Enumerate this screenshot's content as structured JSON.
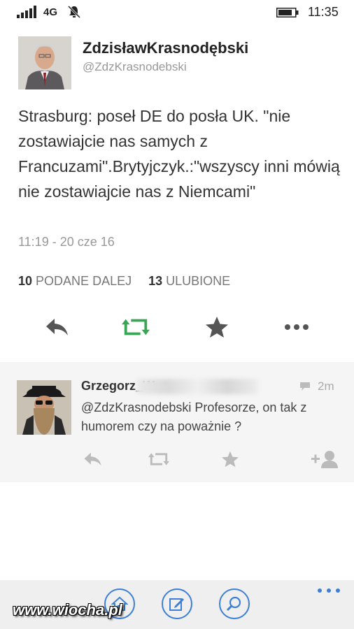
{
  "status_bar": {
    "network": "4G",
    "time": "11:35"
  },
  "tweet": {
    "author_name": "ZdzisławKrasnodębski",
    "author_handle": "@ZdzKrasnodebski",
    "text": "Strasburg: poseł DE do posła UK. \"nie zostawiajcie nas samych z Francuzami\".Brytyjczyk.:\"wszyscy inni mówią nie zostawiajcie nas z Niemcami\"",
    "timestamp": "11:19 - 20 cze 16",
    "retweets_count": "10",
    "retweets_label": "PODANE DALEJ",
    "favorites_count": "13",
    "favorites_label": "ULUBIONE"
  },
  "reply": {
    "author_name_visible": "Grzegorz_Wa",
    "time": "2m",
    "text": "@ZdzKrasnodebski Profesorze, on tak z humorem czy na poważnie ?"
  },
  "watermark": "www.wiocha.pl",
  "colors": {
    "accent_blue": "#3d7fd6",
    "retweet_green": "#3aa655",
    "icon_gray": "#555555",
    "muted_gray": "#bbbbbb"
  }
}
